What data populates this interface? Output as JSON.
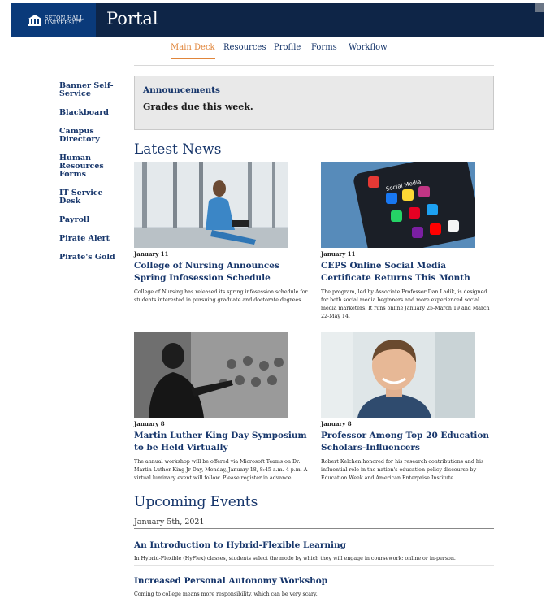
{
  "header": {
    "logo_line1": "SETON HALL",
    "logo_line2": "UNIVERSITY",
    "title": "Portal"
  },
  "tabs": [
    {
      "label": "Main Deck",
      "active": true
    },
    {
      "label": "Resources",
      "active": false
    },
    {
      "label": "Profile",
      "active": false
    },
    {
      "label": "Forms",
      "active": false
    },
    {
      "label": "Workflow",
      "active": false
    }
  ],
  "sidebar": {
    "items": [
      {
        "label": "Banner Self-Service"
      },
      {
        "label": "Blackboard"
      },
      {
        "label": "Campus Directory"
      },
      {
        "label": "Human Resources Forms"
      },
      {
        "label": "IT Service Desk"
      },
      {
        "label": "Payroll"
      },
      {
        "label": "Pirate Alert"
      },
      {
        "label": "Pirate's Gold"
      }
    ]
  },
  "announcements": {
    "title": "Announcements",
    "text": "Grades due this week."
  },
  "latest_news": {
    "heading": "Latest News",
    "items": [
      {
        "date": "January 11",
        "headline": "College of Nursing Announces Spring Infosession Schedule",
        "blurb": "College of Nursing has released its spring infosession schedule for students interested in pursuing graduate and doctorate degrees.",
        "image": "nursing-student-photo"
      },
      {
        "date": "January 11",
        "headline": "CEPS Online Social Media Certificate Returns This Month",
        "blurb": "The program, led by Associate Professor Dan Ladik, is designed for both social media beginners and more experienced social media marketers. It runs online January 25-March 19 and March 22-May 14.",
        "image": "social-media-apps-photo",
        "phone_text": "Social Media"
      },
      {
        "date": "January 8",
        "headline": "Martin Luther King Day Symposium to be Held Virtually",
        "blurb": "The annual workshop will be offered via Microsoft Teams on Dr. Martin Luther King Jr Day, Monday, January 18, 8:45 a.m.-4 p.m. A virtual luminary event will follow. Please register in advance.",
        "image": "mlk-speech-photo"
      },
      {
        "date": "January 8",
        "headline": "Professor Among Top 20 Education Scholars-Influencers",
        "blurb": "Robert Kelchen honored for his research contributions and his influential role in the nation's education policy discourse by Education Week and American Enterprise Institute.",
        "image": "professor-portrait-photo"
      }
    ]
  },
  "upcoming_events": {
    "heading": "Upcoming Events",
    "date": "January 5th, 2021",
    "items": [
      {
        "title": "An Introduction to Hybrid-Flexible Learning",
        "description": "In Hybrid-Flexible (HyFlex) classes, students select the mode by which they will engage in coursework: online or in-person."
      },
      {
        "title": "Increased Personal Autonomy Workshop",
        "description": "Coming to college means more responsibility, which can be very scary."
      }
    ]
  },
  "colors": {
    "header_bg": "#0e2547",
    "link_blue": "#17366b",
    "active_tab": "#e0853a"
  }
}
